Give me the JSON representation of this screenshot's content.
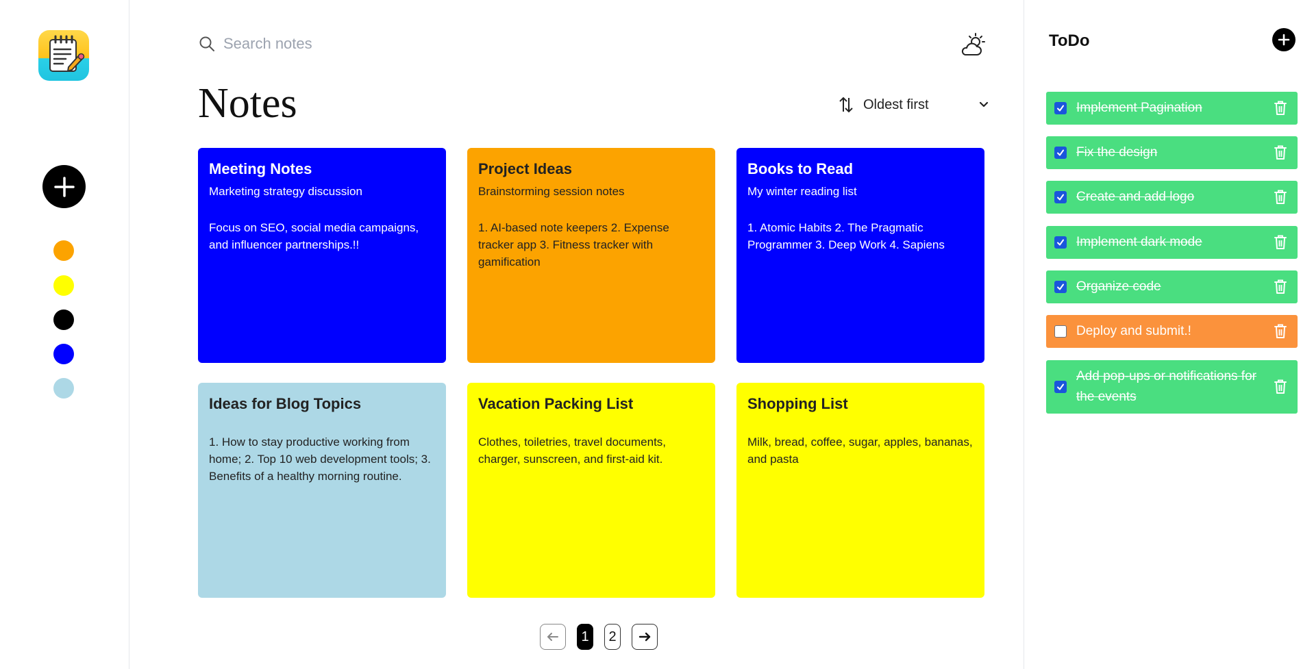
{
  "app": {
    "logo_icon": "notepad-pencil-icon",
    "add_note_icon": "plus-icon",
    "color_filters": [
      {
        "name": "orange",
        "color": "#fca300"
      },
      {
        "name": "yellow",
        "color": "#ffff00"
      },
      {
        "name": "black",
        "color": "#000000"
      },
      {
        "name": "blue",
        "color": "#0000ff"
      },
      {
        "name": "lightblue",
        "color": "#add8e6"
      }
    ]
  },
  "header": {
    "search_placeholder": "Search notes",
    "search_icon": "search-icon",
    "weather_icon": "partly-cloudy-icon",
    "title": "Notes",
    "sort": {
      "label": "Oldest first",
      "icon": "sort-arrows-icon",
      "chevron": "chevron-down-icon"
    }
  },
  "notes": [
    {
      "title": "Meeting Notes",
      "subtitle": "Marketing strategy discussion",
      "body": "Focus on SEO, social media campaigns, and influencer partnerships.!!",
      "color": "#0000ff",
      "theme": "dark"
    },
    {
      "title": "Project Ideas",
      "subtitle": "Brainstorming session notes",
      "body": "1. AI-based note keepers 2. Expense tracker app 3. Fitness tracker with gamification",
      "color": "#fca300",
      "theme": "light"
    },
    {
      "title": "Books to Read",
      "subtitle": "My winter reading list",
      "body": "1. Atomic Habits 2. The Pragmatic Programmer 3. Deep Work 4. Sapiens",
      "color": "#0000ff",
      "theme": "dark"
    },
    {
      "title": "Ideas for Blog Topics",
      "subtitle": "",
      "body": "1. How to stay productive working from home; 2. Top 10 web development tools; 3. Benefits of a healthy morning routine.",
      "color": "#add8e6",
      "theme": "light"
    },
    {
      "title": "Vacation Packing List",
      "subtitle": "",
      "body": "Clothes, toiletries, travel documents, charger, sunscreen, and first-aid kit.",
      "color": "#ffff00",
      "theme": "light"
    },
    {
      "title": "Shopping List",
      "subtitle": "",
      "body": "Milk, bread, coffee, sugar, apples, bananas, and pasta",
      "color": "#ffff00",
      "theme": "light"
    }
  ],
  "pagination": {
    "prev_icon": "arrow-left-icon",
    "next_icon": "arrow-right-icon",
    "pages": [
      "1",
      "2"
    ],
    "current": "1"
  },
  "todo": {
    "title": "ToDo",
    "add_icon": "plus-icon",
    "delete_icon": "trash-icon",
    "items": [
      {
        "text": "Implement Pagination",
        "done": true
      },
      {
        "text": "Fix the design",
        "done": true
      },
      {
        "text": "Create and add logo",
        "done": true
      },
      {
        "text": "Implement dark mode",
        "done": true
      },
      {
        "text": "Organize code",
        "done": true
      },
      {
        "text": "Deploy and submit.!",
        "done": false
      },
      {
        "text": "Add pop-ups or notifications for the events",
        "done": true
      }
    ]
  }
}
